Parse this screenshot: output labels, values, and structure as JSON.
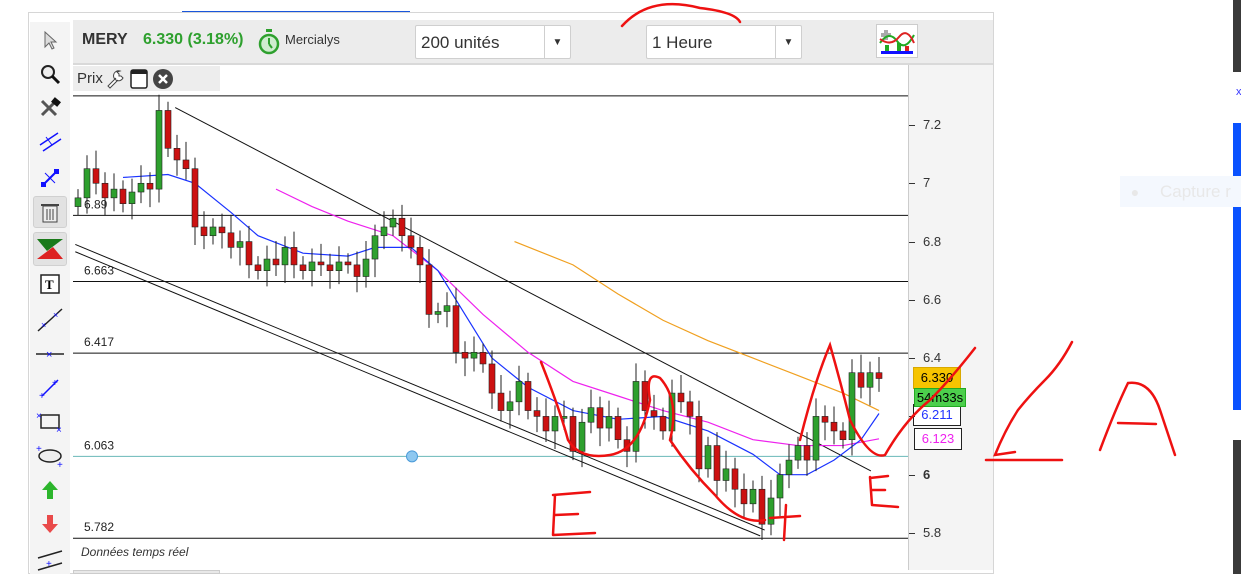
{
  "header": {
    "symbol": "MERY",
    "price": "6.330 (3.18%)",
    "name": "Mercialys",
    "units_select": "200 unités",
    "period_select": "1 Heure"
  },
  "panel": {
    "label": "Prix",
    "footer": "Données temps réel"
  },
  "toolbar": [
    "pointer-icon",
    "zoom-icon",
    "tools-icon",
    "parallel-lines-icon",
    "point-move-icon",
    "trash-icon",
    "indicator-icon",
    "text-icon",
    "trendline-icon",
    "horizontal-line-icon",
    "segment-icon",
    "rectangle-icon",
    "ellipse-icon",
    "arrow-up-icon",
    "arrow-down-icon",
    "channel-icon"
  ],
  "tags": {
    "last": "6.330",
    "countdown": "54m33s",
    "ma_blue": "6.211",
    "ma_magenta": "6.123"
  },
  "side": {
    "capture": "Capture r",
    "x_mark": "x"
  },
  "colors": {
    "up": "#2ea02e",
    "down": "#cc1111",
    "ma_blue": "#1a33ff",
    "ma_magenta": "#ee22ee",
    "ma_orange": "#f0a020",
    "level_teal": "#69b8b8"
  },
  "chart_data": {
    "type": "candlestick",
    "ylim": [
      5.72,
      7.42
    ],
    "yticks": [
      "7.2",
      "7",
      "6.8",
      "6.6",
      "6.4",
      "6.2",
      "6",
      "5.8"
    ],
    "ytick_values": [
      7.2,
      7.0,
      6.8,
      6.6,
      6.4,
      6.2,
      6.0,
      5.8
    ],
    "closes": [
      6.95,
      7.05,
      7.0,
      6.95,
      6.98,
      6.93,
      6.97,
      7.0,
      6.98,
      7.25,
      7.12,
      7.08,
      7.05,
      6.85,
      6.82,
      6.85,
      6.83,
      6.78,
      6.8,
      6.72,
      6.7,
      6.74,
      6.72,
      6.78,
      6.72,
      6.7,
      6.73,
      6.72,
      6.7,
      6.73,
      6.72,
      6.68,
      6.74,
      6.82,
      6.85,
      6.88,
      6.82,
      6.78,
      6.72,
      6.55,
      6.56,
      6.58,
      6.42,
      6.4,
      6.42,
      6.38,
      6.28,
      6.22,
      6.25,
      6.32,
      6.22,
      6.2,
      6.15,
      6.2,
      6.2,
      6.08,
      6.18,
      6.23,
      6.16,
      6.2,
      6.12,
      6.08,
      6.32,
      6.22,
      6.2,
      6.15,
      6.28,
      6.25,
      6.2,
      6.02,
      6.1,
      5.98,
      6.02,
      5.95,
      5.9,
      5.95,
      5.83,
      5.92,
      6.0,
      6.05,
      6.1,
      6.05,
      6.2,
      6.18,
      6.15,
      6.12,
      6.35,
      6.3,
      6.35,
      6.33
    ],
    "levels": [
      {
        "value": 7.3,
        "label": ""
      },
      {
        "value": 6.89,
        "label": "6.89"
      },
      {
        "value": 6.663,
        "label": "6.663"
      },
      {
        "value": 6.417,
        "label": "6.417"
      },
      {
        "value": 6.063,
        "label": "6.063",
        "teal": true
      },
      {
        "value": 5.782,
        "label": "5.782"
      }
    ],
    "ma_blue": [
      [
        5,
        7.02
      ],
      [
        10,
        7.03
      ],
      [
        13,
        7.0
      ],
      [
        17,
        6.9
      ],
      [
        20,
        6.82
      ],
      [
        25,
        6.76
      ],
      [
        30,
        6.75
      ],
      [
        33,
        6.78
      ],
      [
        37,
        6.78
      ],
      [
        40,
        6.7
      ],
      [
        43,
        6.55
      ],
      [
        46,
        6.4
      ],
      [
        50,
        6.3
      ],
      [
        55,
        6.22
      ],
      [
        60,
        6.19
      ],
      [
        65,
        6.2
      ],
      [
        70,
        6.15
      ],
      [
        75,
        6.07
      ],
      [
        78,
        6.0
      ],
      [
        81,
        6.0
      ],
      [
        84,
        6.05
      ],
      [
        87,
        6.12
      ],
      [
        89,
        6.21
      ]
    ],
    "ma_magenta": [
      [
        22,
        6.98
      ],
      [
        26,
        6.92
      ],
      [
        30,
        6.87
      ],
      [
        35,
        6.82
      ],
      [
        40,
        6.7
      ],
      [
        45,
        6.55
      ],
      [
        50,
        6.42
      ],
      [
        55,
        6.32
      ],
      [
        60,
        6.27
      ],
      [
        65,
        6.22
      ],
      [
        70,
        6.18
      ],
      [
        75,
        6.12
      ],
      [
        80,
        6.1
      ],
      [
        85,
        6.1
      ],
      [
        89,
        6.123
      ]
    ],
    "ma_orange": [
      [
        48.5,
        6.8
      ],
      [
        55,
        6.72
      ],
      [
        60,
        6.62
      ],
      [
        65,
        6.53
      ],
      [
        70,
        6.46
      ],
      [
        75,
        6.4
      ],
      [
        80,
        6.34
      ],
      [
        85,
        6.28
      ],
      [
        89,
        6.22
      ]
    ],
    "trendlines": [
      [
        [
          10.8,
          7.26
        ],
        [
          88.1,
          6.013
        ]
      ],
      [
        [
          -0.3,
          6.79
        ],
        [
          76.3,
          5.81
        ]
      ],
      [
        [
          -0.3,
          6.765
        ],
        [
          75.8,
          5.79
        ]
      ]
    ]
  }
}
